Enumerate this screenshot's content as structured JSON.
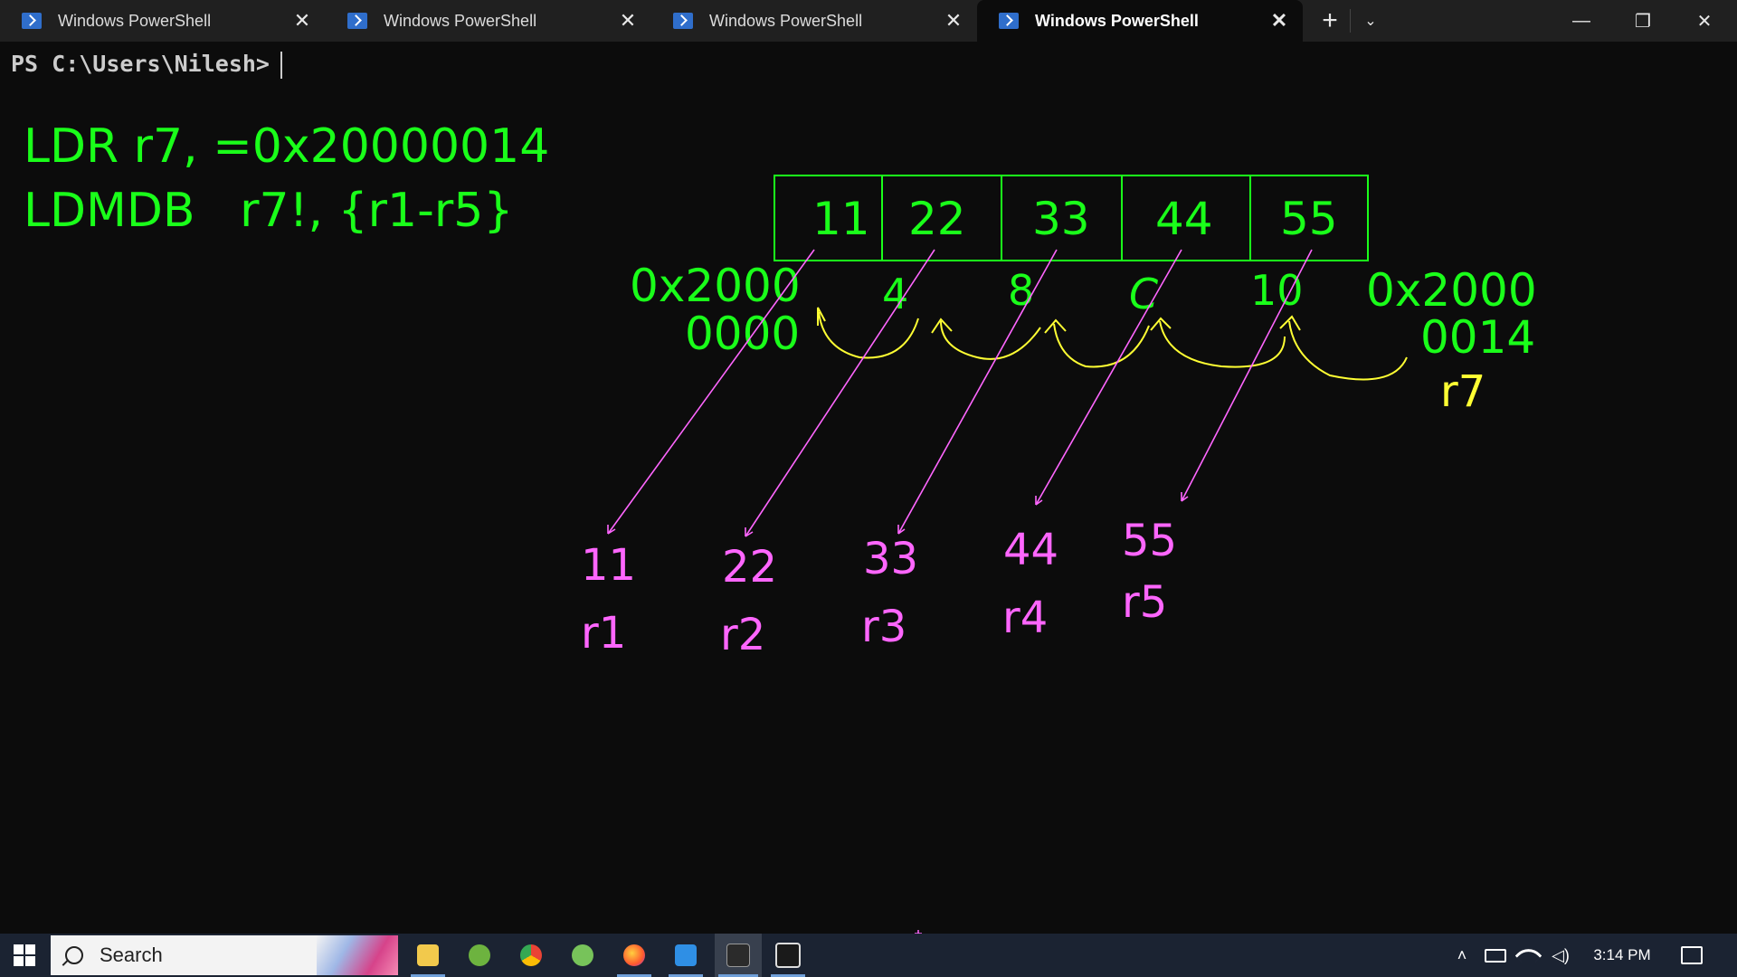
{
  "tabs": [
    {
      "title": "Windows PowerShell",
      "close": "✕",
      "active": false
    },
    {
      "title": "Windows PowerShell",
      "close": "✕",
      "active": false
    },
    {
      "title": "Windows PowerShell",
      "close": "✕",
      "active": false
    },
    {
      "title": "Windows PowerShell",
      "close": "✕",
      "active": true
    }
  ],
  "tabbar": {
    "new_tab": "+",
    "dropdown": "⌄"
  },
  "window_controls": {
    "minimize": "—",
    "restore": "❐",
    "close": "✕"
  },
  "terminal": {
    "prompt": "PS C:\\Users\\Nilesh>"
  },
  "drawing": {
    "instructions": [
      "LDR r7, =0x20000014",
      "LDMDB   r7!, {r1-r5}"
    ],
    "memory_cells": [
      "11",
      "22",
      "33",
      "44",
      "55"
    ],
    "base_address": [
      "0x2000",
      "0000"
    ],
    "offsets": [
      "4",
      "8",
      "C",
      "10"
    ],
    "end_address": [
      "0x2000",
      "0014"
    ],
    "pointer_register": "r7",
    "registers": [
      {
        "value": "11",
        "name": "r1"
      },
      {
        "value": "22",
        "name": "r2"
      },
      {
        "value": "33",
        "name": "r3"
      },
      {
        "value": "44",
        "name": "r4"
      },
      {
        "value": "55",
        "name": "r5"
      }
    ],
    "colors": {
      "green": "#1aff1a",
      "yellow": "#ffff33",
      "pink": "#ff66ff"
    }
  },
  "taskbar": {
    "search_placeholder": "Search",
    "apps": [
      "file-explorer-icon",
      "spring-tool-icon",
      "chrome-icon",
      "spring-boot-icon",
      "firefox-icon",
      "vscode-icon",
      "terminal-icon",
      "media-app-icon"
    ],
    "time": "3:14 PM"
  }
}
